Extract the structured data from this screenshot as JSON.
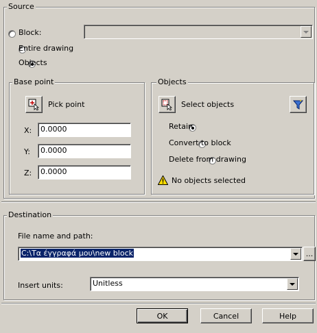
{
  "source": {
    "legend": "Source",
    "block_label": "Block:",
    "entire_drawing_label": "Entire drawing",
    "objects_label": "Objects",
    "selected": "objects"
  },
  "base_point": {
    "legend": "Base point",
    "pick_point_label": "Pick point",
    "x_label": "X:",
    "x_value": "0.0000",
    "y_label": "Y:",
    "y_value": "0.0000",
    "z_label": "Z:",
    "z_value": "0.0000"
  },
  "objects": {
    "legend": "Objects",
    "select_objects_label": "Select objects",
    "retain_label": "Retain",
    "convert_label": "Convert to block",
    "delete_label": "Delete from drawing",
    "selected": "retain",
    "warning": "No objects selected"
  },
  "destination": {
    "legend": "Destination",
    "path_label": "File name and path:",
    "path_value": "C:\\Τα έγγραφά μου\\new block",
    "browse_label": "...",
    "units_label": "Insert units:",
    "units_value": "Unitless"
  },
  "buttons": {
    "ok": "OK",
    "cancel": "Cancel",
    "help": "Help"
  }
}
